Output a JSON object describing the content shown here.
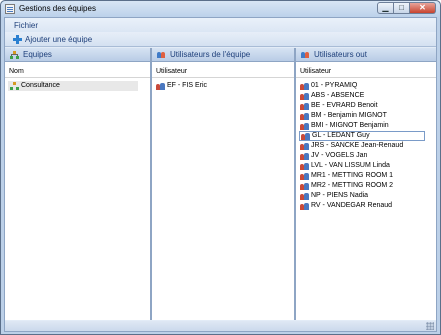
{
  "window": {
    "title": "Gestions des équipes"
  },
  "menu": {
    "file": "Fichier"
  },
  "toolbar": {
    "add_team": "Ajouter une équipe"
  },
  "panels": {
    "teams": {
      "title": "Equipes",
      "column": "Nom",
      "items": [
        "Consultance"
      ]
    },
    "team_users": {
      "title": "Utilisateurs de l'équipe",
      "column": "Utilisateur",
      "items": [
        "EF - FIS Eric"
      ]
    },
    "users_out": {
      "title": "Utilisateurs out",
      "column": "Utilisateur",
      "items": [
        "01 - PYRAMIQ",
        "ABS - ABSENCE",
        "BE - EVRARD Benoit",
        "BM - Benjamin MIGNOT",
        "BMI - MIGNOT Benjamin",
        "GL - LEDANT Guy",
        "JRS - SANCKE Jean-Renaud",
        "JV - VOGELS Jan",
        "LVL - VAN LISSUM Linda",
        "MR1 - METTING ROOM 1",
        "MR2 - METTING ROOM 2",
        "NP - PIENS Nadia",
        "RV - VANDEGAR Renaud"
      ]
    }
  }
}
